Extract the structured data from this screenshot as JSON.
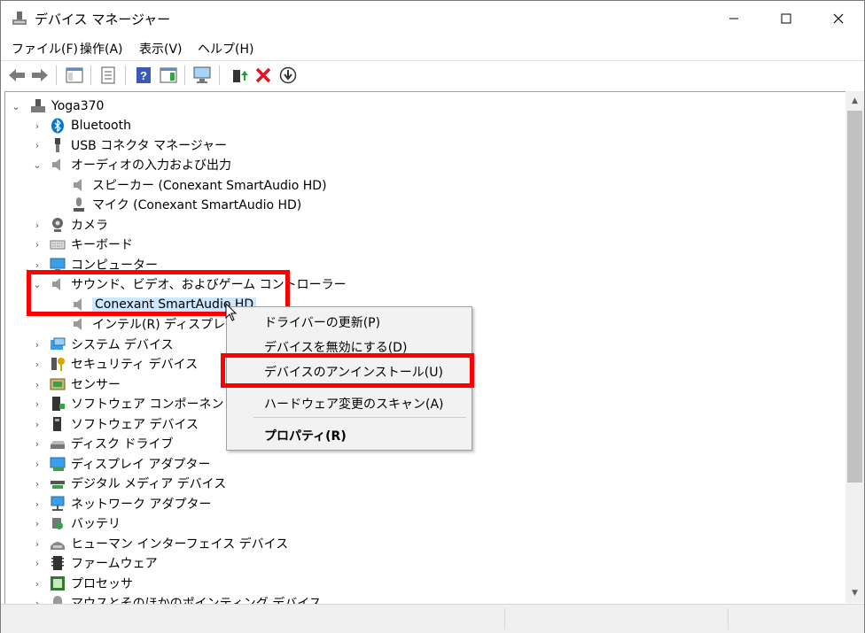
{
  "window": {
    "title": "デバイス マネージャー"
  },
  "menu": [
    "ファイル(F)",
    "操作(A)",
    "表示(V)",
    "ヘルプ(H)"
  ],
  "tree": {
    "root": "Yoga370",
    "items": [
      "Bluetooth",
      "USB コネクタ マネージャー",
      "オーディオの入力および出力",
      "スピーカー (Conexant SmartAudio HD)",
      "マイク (Conexant SmartAudio HD)",
      "カメラ",
      "キーボード",
      "コンピューター",
      "サウンド、ビデオ、およびゲーム コントローラー",
      "Conexant SmartAudio HD",
      "インテル(R) ディスプレイ用オ",
      "システム デバイス",
      "セキュリティ デバイス",
      "センサー",
      "ソフトウェア コンポーネント",
      "ソフトウェア デバイス",
      "ディスク ドライブ",
      "ディスプレイ アダプター",
      "デジタル メディア デバイス",
      "ネットワーク アダプター",
      "バッテリ",
      "ヒューマン インターフェイス デバイス",
      "ファームウェア",
      "プロセッサ",
      "マウスとそのほかのポインティング デバイス"
    ]
  },
  "context_menu": {
    "update_driver": "ドライバーの更新(P)",
    "disable_device": "デバイスを無効にする(D)",
    "uninstall_device": "デバイスのアンインストール(U)",
    "scan_hardware": "ハードウェア変更のスキャン(A)",
    "properties": "プロパティ(R)"
  },
  "colors": {
    "highlight": "#ff0000",
    "selection": "#cce8ff",
    "accent": "#0078d7"
  }
}
